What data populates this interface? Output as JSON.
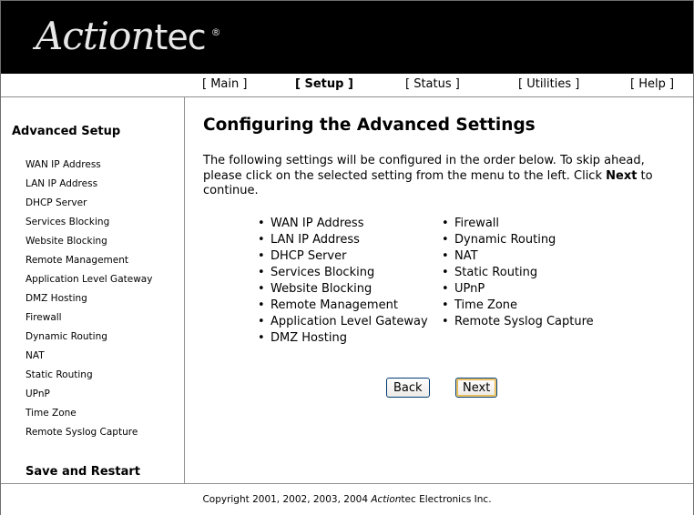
{
  "brand": {
    "logo_action": "Action",
    "logo_tec": "tec",
    "logo_reg": "®"
  },
  "nav": {
    "items": [
      {
        "label": "[ Main ]"
      },
      {
        "label": "[ Setup ]"
      },
      {
        "label": "[ Status ]"
      },
      {
        "label": "[ Utilities ]"
      },
      {
        "label": "[ Help ]"
      }
    ],
    "active": "Setup"
  },
  "sidebar": {
    "title": "Advanced Setup",
    "items": [
      {
        "label": "WAN IP Address"
      },
      {
        "label": "LAN IP Address"
      },
      {
        "label": "DHCP Server"
      },
      {
        "label": "Services Blocking"
      },
      {
        "label": "Website Blocking"
      },
      {
        "label": "Remote Management"
      },
      {
        "label": "Application Level Gateway"
      },
      {
        "label": "DMZ Hosting"
      },
      {
        "label": "Firewall"
      },
      {
        "label": "Dynamic Routing"
      },
      {
        "label": "NAT"
      },
      {
        "label": "Static Routing"
      },
      {
        "label": "UPnP"
      },
      {
        "label": "Time Zone"
      },
      {
        "label": "Remote Syslog Capture"
      }
    ],
    "save_label": "Save and Restart"
  },
  "main": {
    "title": "Configuring the Advanced Settings",
    "intro_before": "The following settings will be configured in the order below. To skip ahead, please click on the selected setting from the menu to the left. Click ",
    "intro_bold": "Next",
    "intro_after": " to continue.",
    "col1": [
      "WAN IP Address",
      "LAN IP Address",
      "DHCP Server",
      "Services Blocking",
      "Website Blocking",
      "Remote Management",
      "Application Level Gateway",
      "DMZ Hosting"
    ],
    "col2": [
      "Firewall",
      "Dynamic Routing",
      "NAT",
      "Static Routing",
      "UPnP",
      "Time Zone",
      "Remote Syslog Capture"
    ],
    "back_label": "Back",
    "next_label": "Next"
  },
  "footer": {
    "before": "Copyright 2001, 2002, 2003, 2004 ",
    "brand_action": "Action",
    "brand_tec": "tec",
    "after": " Electronics Inc."
  }
}
